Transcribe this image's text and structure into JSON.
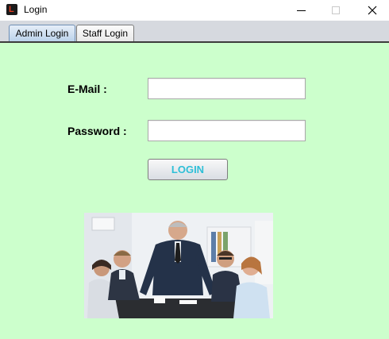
{
  "window": {
    "title": "Login"
  },
  "tabs": [
    {
      "label": "Admin Login",
      "selected": true
    },
    {
      "label": "Staff Login",
      "selected": false
    }
  ],
  "form": {
    "email_label": "E-Mail :",
    "email_value": "",
    "password_label": "Password :",
    "password_value": "",
    "login_button": "LOGIN"
  },
  "colors": {
    "panel_background": "#ccffcc",
    "login_text": "#2ebfd7",
    "tab_selected": "#b9d1ea"
  },
  "icons": [
    "app-logo-icon",
    "minimize-icon",
    "maximize-icon",
    "close-icon"
  ]
}
